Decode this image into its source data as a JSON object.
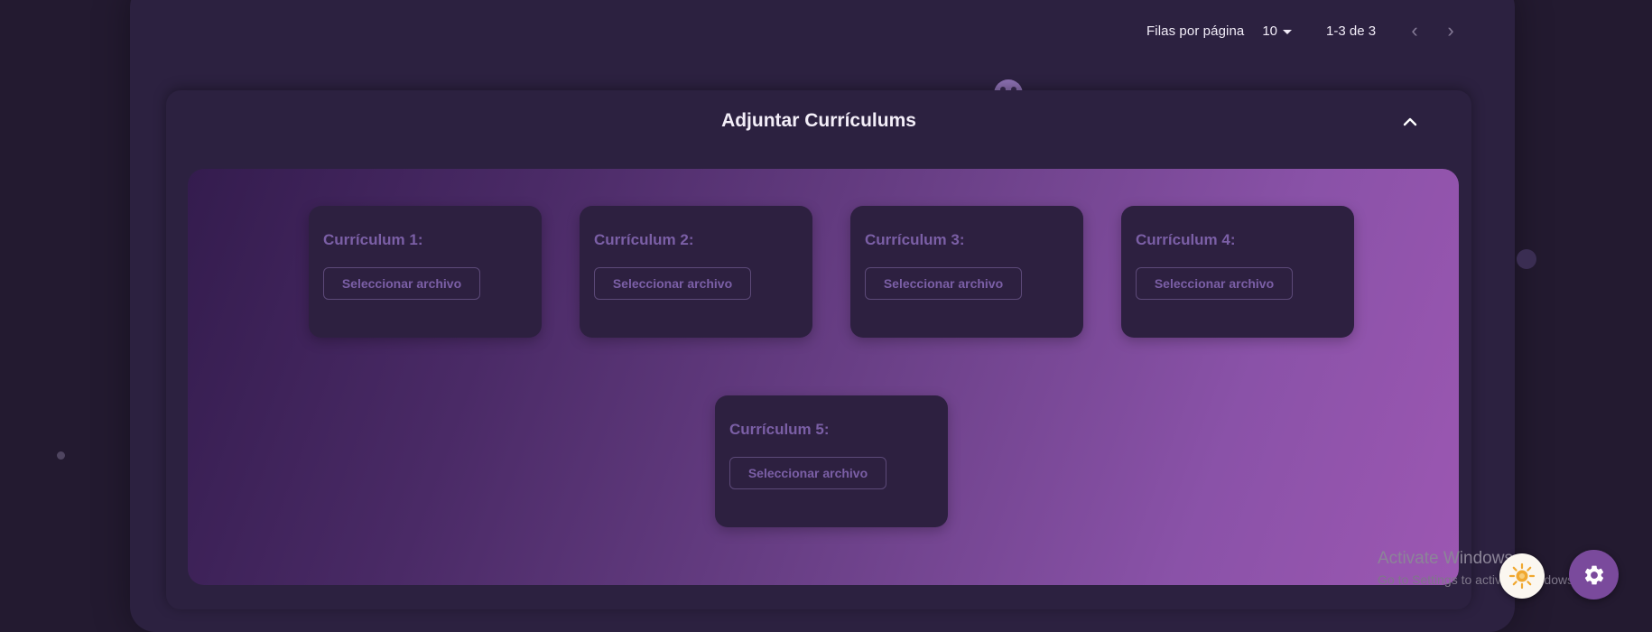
{
  "pagination": {
    "rows_label": "Filas por página",
    "rows_value": "10",
    "range_text": "1-3 de 3",
    "prev_icon": "chevron-left-icon",
    "next_icon": "chevron-right-icon"
  },
  "section": {
    "title": "Adjuntar Currículums",
    "collapse_icon": "chevron-up-icon"
  },
  "curriculums": [
    {
      "label": "Currículum 1:",
      "button": "Seleccionar archivo"
    },
    {
      "label": "Currículum 2:",
      "button": "Seleccionar archivo"
    },
    {
      "label": "Currículum 3:",
      "button": "Seleccionar archivo"
    },
    {
      "label": "Currículum 4:",
      "button": "Seleccionar archivo"
    },
    {
      "label": "Currículum 5:",
      "button": "Seleccionar archivo"
    }
  ],
  "watermark": {
    "title": "Activate Windows",
    "subtitle": "Go to Settings to activate Windows."
  },
  "fabs": {
    "theme_icon": "sun-icon",
    "settings_icon": "gear-icon"
  },
  "colors": {
    "background": "#231a30",
    "card": "#2c2140",
    "accent": "#7a4a9c",
    "gradient_start": "#341c4e",
    "gradient_end": "#9c57b2",
    "label_purple": "#7b5fa6"
  }
}
